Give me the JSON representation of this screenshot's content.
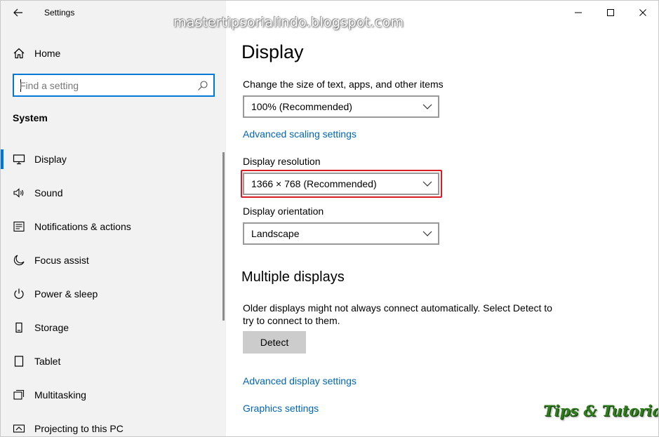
{
  "window": {
    "title": "Settings"
  },
  "watermark": "mastertipsorialindo.blogspot.com",
  "sidebar": {
    "home_label": "Home",
    "search_placeholder": "Find a setting",
    "section_title": "System",
    "items": [
      {
        "label": "Display",
        "icon": "monitor-icon",
        "selected": true
      },
      {
        "label": "Sound",
        "icon": "speaker-icon",
        "selected": false
      },
      {
        "label": "Notifications & actions",
        "icon": "notification-icon",
        "selected": false
      },
      {
        "label": "Focus assist",
        "icon": "moon-icon",
        "selected": false
      },
      {
        "label": "Power & sleep",
        "icon": "power-icon",
        "selected": false
      },
      {
        "label": "Storage",
        "icon": "storage-icon",
        "selected": false
      },
      {
        "label": "Tablet",
        "icon": "tablet-icon",
        "selected": false
      },
      {
        "label": "Multitasking",
        "icon": "multitasking-icon",
        "selected": false
      },
      {
        "label": "Projecting to this PC",
        "icon": "projecting-icon",
        "selected": false
      }
    ]
  },
  "main": {
    "title": "Display",
    "scale_label": "Change the size of text, apps, and other items",
    "scale_value": "100% (Recommended)",
    "advanced_scaling_link": "Advanced scaling settings",
    "resolution_label": "Display resolution",
    "resolution_value": "1366 × 768 (Recommended)",
    "orientation_label": "Display orientation",
    "orientation_value": "Landscape",
    "multiple_title": "Multiple displays",
    "multiple_desc": "Older displays might not always connect automatically. Select Detect to try to connect to them.",
    "detect_button": "Detect",
    "advanced_display_link": "Advanced display settings",
    "graphics_link": "Graphics settings"
  },
  "logo": "Tips & Tutorial",
  "colors": {
    "accent": "#0078d7",
    "link": "#0066b4",
    "highlight": "#d81c24",
    "sidebar_bg": "#f2f2f2"
  }
}
